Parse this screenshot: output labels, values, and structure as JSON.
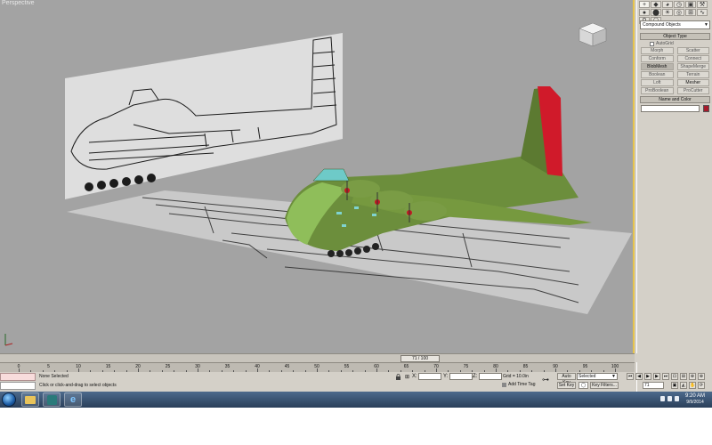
{
  "viewport": {
    "label": "Perspective"
  },
  "colors": {
    "tail_fin": "#d01a2a",
    "fuselage": "#6c8e3c",
    "nose": "#8fbe5a",
    "viewport_bg": "#a3a3a3",
    "accent_border": "#e6c34c"
  },
  "command_panel": {
    "tabs": [
      "+",
      "◆",
      "◕",
      "◷",
      "▣",
      "⚒",
      "●",
      "⬤",
      "☀",
      "◎",
      "⊞",
      "∿",
      "⚲",
      "⎔"
    ],
    "category": "Compound Objects",
    "object_type_title": "Object Type",
    "autogrid_label": "AutoGrid",
    "buttons": [
      {
        "label": "Morph",
        "state": "disabled"
      },
      {
        "label": "Scatter",
        "state": "disabled"
      },
      {
        "label": "Conform",
        "state": "disabled"
      },
      {
        "label": "Connect",
        "state": "disabled"
      },
      {
        "label": "BlobMesh",
        "state": "pressed"
      },
      {
        "label": "ShapeMerge",
        "state": "disabled"
      },
      {
        "label": "Boolean",
        "state": "disabled"
      },
      {
        "label": "Terrain",
        "state": "disabled"
      },
      {
        "label": "Loft",
        "state": "disabled"
      },
      {
        "label": "Mesher",
        "state": "enabled"
      },
      {
        "label": "ProBoolean",
        "state": "disabled"
      },
      {
        "label": "ProCutter",
        "state": "disabled"
      }
    ],
    "name_color_title": "Name and Color"
  },
  "timeline": {
    "slider_label": "71 / 100",
    "ticks": [
      "0",
      "5",
      "10",
      "15",
      "20",
      "25",
      "30",
      "35",
      "40",
      "45",
      "50",
      "55",
      "60",
      "65",
      "70",
      "75",
      "80",
      "85",
      "90",
      "95",
      "100"
    ]
  },
  "status": {
    "selection": "None Selected",
    "prompt": "Click or click-and-drag to select objects",
    "x_label": "X:",
    "y_label": "Y:",
    "z_label": "Z:",
    "grid": "Grid = 10.0in",
    "add_time_tag": "Add Time Tag",
    "auto_key": "Auto Key",
    "set_key": "Set Key",
    "selected_option": "Selected",
    "key_filters": "Key Filters...",
    "frame_value": "71"
  },
  "taskbar": {
    "time": "9:20 AM",
    "date": "9/9/2014"
  }
}
